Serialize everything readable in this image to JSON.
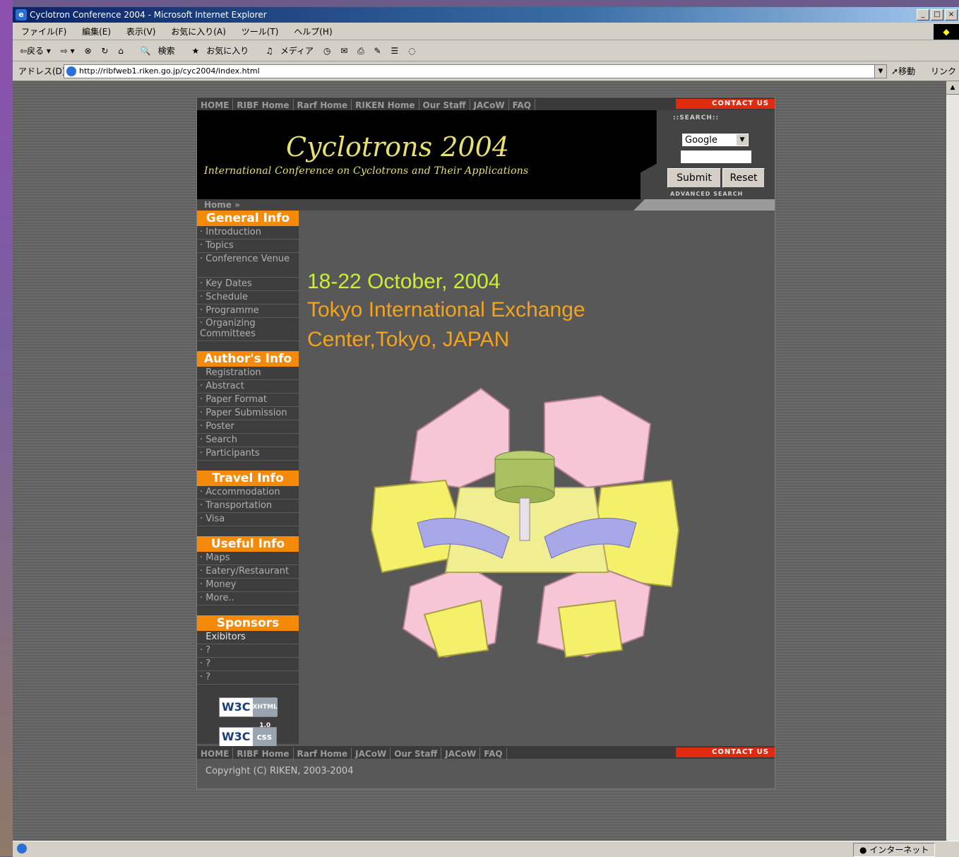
{
  "window": {
    "title": "Cyclotron Conference 2004 - Microsoft Internet Explorer",
    "controls": [
      "_",
      "□",
      "×"
    ]
  },
  "menu": [
    "ファイル(F)",
    "編集(E)",
    "表示(V)",
    "お気に入り(A)",
    "ツール(T)",
    "ヘルプ(H)"
  ],
  "toolbar": {
    "back": "⇦戻る ▾",
    "forward": "⇨ ▾",
    "search": "検索",
    "favorites": "お気に入り",
    "media": "メディア"
  },
  "address": {
    "label": "アドレス(D)",
    "url": "http://ribfweb1.riken.go.jp/cyc2004/index.html",
    "go": "移動",
    "links": "リンク"
  },
  "status": {
    "zone": "インターネット"
  },
  "page": {
    "topnav": [
      "HOME",
      "RIBF Home",
      "Rarf Home",
      "RIKEN Home",
      "Our Staff",
      "JACoW",
      "FAQ"
    ],
    "contact": "CONTACT US",
    "banner": {
      "title": "Cyclotrons 2004",
      "subtitle": "International Conference on Cyclotrons and Their Applications"
    },
    "search": {
      "heading": "::SEARCH::",
      "engine": "Google",
      "submit": "Submit",
      "reset": "Reset",
      "advanced": "ADVANCED SEARCH"
    },
    "breadcrumb": "Home »",
    "sidebar": {
      "general": {
        "heading": "General Info",
        "items": [
          "Introduction",
          "Topics",
          "Conference Venue",
          "Key Dates",
          "Schedule",
          "Programme",
          "Organizing Committees"
        ]
      },
      "author": {
        "heading": "Author's Info",
        "items": [
          "Registration",
          "Abstract",
          "Paper Format",
          "Paper Submission",
          "Poster",
          "Search",
          "Participants"
        ]
      },
      "travel": {
        "heading": "Travel Info",
        "items": [
          "Accommodation",
          "Transportation",
          "Visa"
        ]
      },
      "useful": {
        "heading": "Useful Info",
        "items": [
          "Maps",
          "Eatery/Restaurant",
          "Money",
          "More.."
        ]
      },
      "sponsors": {
        "heading": "Sponsors",
        "items": [
          "Exibitors",
          "?",
          "?",
          "?"
        ]
      },
      "badges": {
        "xhtml_left": "W3C",
        "xhtml_right": "XHTML 1.0",
        "css_left": "W3C",
        "css_right": "css"
      }
    },
    "main": {
      "date": "18-22 October, 2004",
      "venue_line1": "Tokyo International Exchange",
      "venue_line2": "Center,Tokyo, JAPAN"
    },
    "footnav": [
      "HOME",
      "RIBF Home",
      "Rarf Home",
      "JACoW",
      "Our Staff",
      "JACoW",
      "FAQ"
    ],
    "copyright": "Copyright (C) RIKEN, 2003-2004"
  }
}
